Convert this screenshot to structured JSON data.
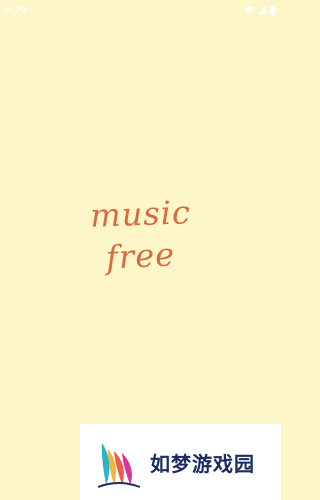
{
  "status_bar": {
    "time": "6:29",
    "icons": [
      "wifi-icon",
      "signal-icon",
      "battery-icon"
    ]
  },
  "splash": {
    "line1": "music",
    "line2": "free",
    "text_color": "#d86a42",
    "background_color": "#fdf6c9"
  },
  "watermark": {
    "text": "如梦游戏园"
  }
}
